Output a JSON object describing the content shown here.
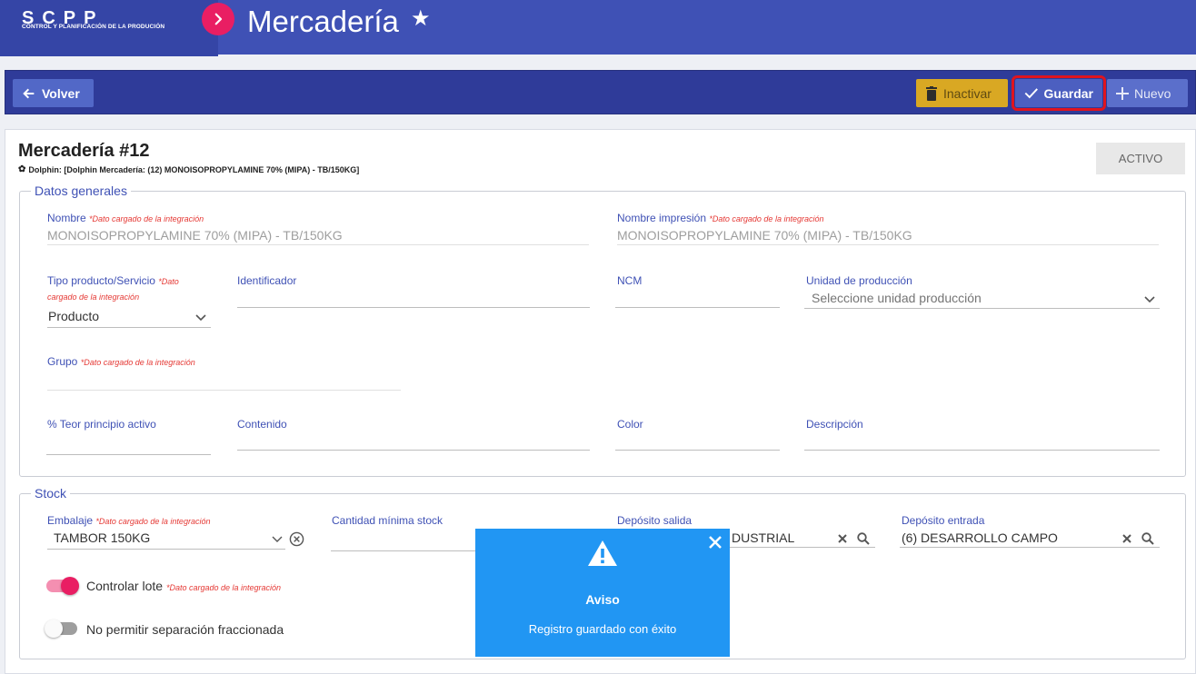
{
  "header": {
    "logo_text": "SCPP",
    "logo_subtitle": "CONTROL Y PLANIFICACIÓN DE LA PRODUCIÓN",
    "title": "Mercadería",
    "accent": "#e91e63",
    "brand": "#3f51b5"
  },
  "toolbar": {
    "back_label": "Volver",
    "inactivar_label": "Inactivar",
    "guardar_label": "Guardar",
    "nuevo_label": "Nuevo"
  },
  "record": {
    "title": "Mercadería #12",
    "subtitle": "Dolphin: [Dolphin Mercadería: (12) MONOISOPROPYLAMINE 70% (MIPA) - TB/150KG]",
    "status": "ACTIVO"
  },
  "integration_note": "*Dato cargado de la integración",
  "datos_generales": {
    "legend": "Datos generales",
    "nombre": {
      "label": "Nombre",
      "value": "MONOISOPROPYLAMINE 70% (MIPA) - TB/150KG"
    },
    "nombre_impresion": {
      "label": "Nombre impresión",
      "value": "MONOISOPROPYLAMINE 70% (MIPA) - TB/150KG"
    },
    "tipo": {
      "label": "Tipo producto/Servicio",
      "note_line1": "*Dato",
      "note_line2": "cargado de la integración",
      "value": "Producto"
    },
    "identificador": {
      "label": "Identificador",
      "value": ""
    },
    "ncm": {
      "label": "NCM",
      "value": ""
    },
    "unidad": {
      "label": "Unidad de producción",
      "placeholder": "Seleccione unidad producción"
    },
    "grupo": {
      "label": "Grupo",
      "value": ""
    },
    "teor": {
      "label": "% Teor principio activo",
      "value": ""
    },
    "contenido": {
      "label": "Contenido",
      "value": ""
    },
    "color": {
      "label": "Color",
      "value": ""
    },
    "descripcion": {
      "label": "Descripción",
      "value": ""
    }
  },
  "stock": {
    "legend": "Stock",
    "embalaje": {
      "label": "Embalaje",
      "value": "TAMBOR 150KG"
    },
    "cantidad_minima": {
      "label": "Cantidad mínima stock",
      "value": ""
    },
    "deposito_salida": {
      "label": "Depósito salida",
      "value": "DUSTRIAL"
    },
    "deposito_entrada": {
      "label": "Depósito entrada",
      "value": "(6) DESARROLLO CAMPO"
    },
    "controlar_lote": {
      "label": "Controlar lote",
      "on": true
    },
    "no_permitir": {
      "label": "No permitir separación fraccionada",
      "on": false
    }
  },
  "toast": {
    "title": "Aviso",
    "message": "Registro guardado con éxito",
    "color": "#2196f3"
  }
}
